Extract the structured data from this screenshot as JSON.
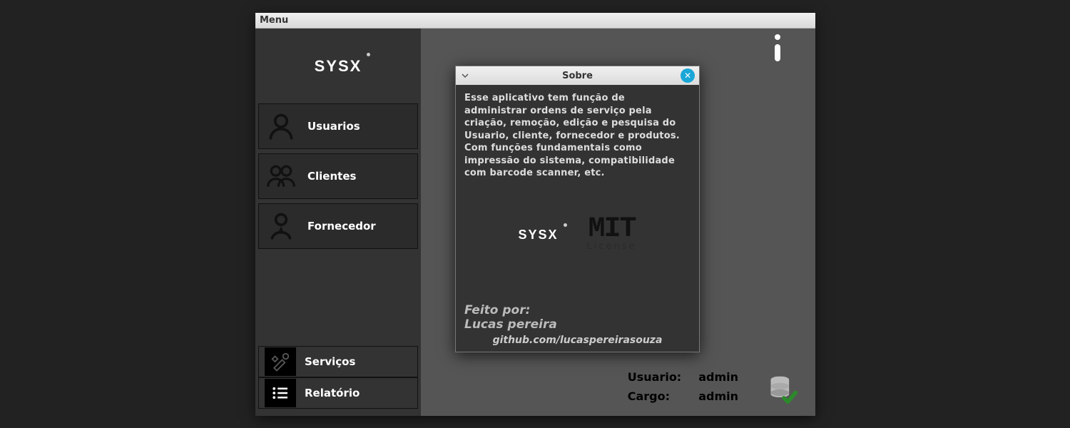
{
  "menubar": {
    "menu_label": "Menu"
  },
  "brand": {
    "name": "SYSX"
  },
  "sidebar": {
    "items": [
      {
        "label": "Usuarios",
        "icon": "user-icon"
      },
      {
        "label": "Clientes",
        "icon": "users-icon"
      },
      {
        "label": "Fornecedor",
        "icon": "supplier-icon"
      }
    ],
    "lower": [
      {
        "label": "Serviços",
        "icon": "tools-icon"
      },
      {
        "label": "Relatório",
        "icon": "list-icon"
      }
    ]
  },
  "status": {
    "user_label": "Usuario:",
    "user_value": "admin",
    "role_label": "Cargo:",
    "role_value": "admin"
  },
  "about": {
    "title": "Sobre",
    "description": "Esse aplicativo tem função de administrar ordens de serviço pela criação, remoção, edição e pesquisa do Usuario, cliente, fornecedor e produtos. Com funções fundamentais como impressão do sistema, compatibilidade com barcode scanner, etc.",
    "license": "MIT",
    "license_sub": "License",
    "credit_label": "Feito por:",
    "author": "Lucas pereira",
    "link": "github.com/lucaspereirasouza"
  }
}
